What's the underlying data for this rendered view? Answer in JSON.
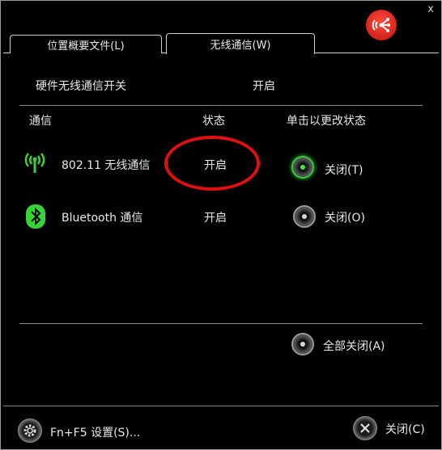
{
  "window": {
    "close_glyph": "x"
  },
  "tabs": [
    {
      "label": "位置概要文件(L)",
      "active": false
    },
    {
      "label": "无线通信(W)",
      "active": true
    }
  ],
  "hardware": {
    "label": "硬件无线通信开关",
    "value": "开启"
  },
  "table": {
    "headers": {
      "comm": "通信",
      "status": "状态",
      "action": "单击以更改状态"
    },
    "rows": [
      {
        "icon": "wifi-antenna-icon",
        "name": "802.11 无线通信",
        "status": "开启",
        "action": "关闭(T)",
        "active": true
      },
      {
        "icon": "bluetooth-icon",
        "name": "Bluetooth 通信",
        "status": "开启",
        "action": "关闭(O)",
        "active": false
      }
    ]
  },
  "all_off": {
    "label": "全部关闭(A)"
  },
  "footer": {
    "settings_label": "Fn+F5 设置(S)...",
    "close_label": "关闭(C)"
  },
  "colors": {
    "accent_green": "#3ec73e",
    "highlight_red": "#e01010",
    "logo_red": "#d81a10"
  }
}
